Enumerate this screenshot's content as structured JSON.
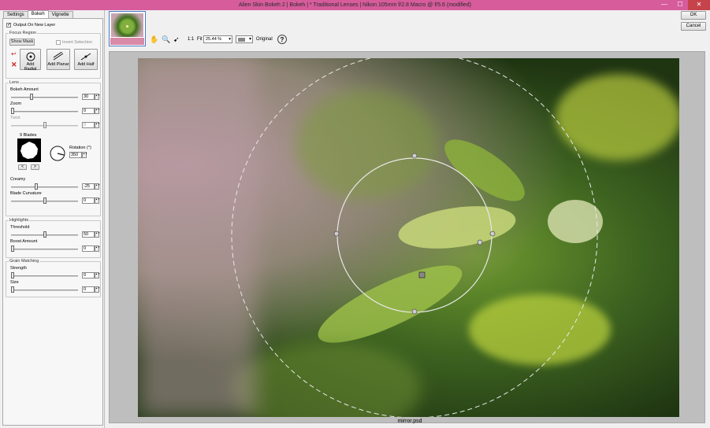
{
  "window": {
    "title": "Alien Skin Bokeh 2 | Bokeh | * Traditional Lenses | Nikon 105mm f/2.8 Macro @ f/5.6 (modified)",
    "minimize": "—",
    "maximize": "☐",
    "close": "✕"
  },
  "tabs": [
    "Settings",
    "Bokeh",
    "Vignette"
  ],
  "output_new_layer": {
    "label": "Output On New Layer",
    "checked": true
  },
  "focus_region": {
    "title": "Focus Region",
    "show_mask": "Show Mask",
    "invert_selection": "Invert Selection",
    "add_radial": "Add Radial",
    "add_planar": "Add Planar",
    "add_half": "Add Half"
  },
  "lens": {
    "title": "Lens",
    "bokeh_amount": {
      "label": "Bokeh Amount",
      "value": "30",
      "level": 0.3
    },
    "zoom": {
      "label": "Zoom",
      "value": "0",
      "level": 0.0
    },
    "twist": {
      "label": "Twist",
      "value": "0",
      "level": 0.5
    },
    "blades": "9 Blades",
    "rotation": {
      "label": "Rotation (°)",
      "value": "350"
    },
    "blade_prev": "<",
    "blade_next": ">",
    "creamy": {
      "label": "Creamy",
      "value": "-25",
      "level": 0.375
    },
    "blade_curvature": {
      "label": "Blade Curvature",
      "value": "0",
      "level": 0.5
    }
  },
  "highlights": {
    "title": "Highlights",
    "threshold": {
      "label": "Threshold",
      "value": "50",
      "level": 0.5
    },
    "boost_amount": {
      "label": "Boost Amount",
      "value": "0",
      "level": 0.0
    }
  },
  "grain": {
    "title": "Grain Matching",
    "strength": {
      "label": "Strength",
      "value": "0",
      "level": 0.0
    },
    "size": {
      "label": "Size",
      "value": "0",
      "level": 0.0
    }
  },
  "toolbar": {
    "zoom_1to1": "1:1",
    "fit": "Fit",
    "zoom_value": "25.44 %",
    "original": "Original",
    "help": "?"
  },
  "buttons": {
    "ok": "OK",
    "cancel": "Cancel"
  },
  "filename": "mirror.psd"
}
